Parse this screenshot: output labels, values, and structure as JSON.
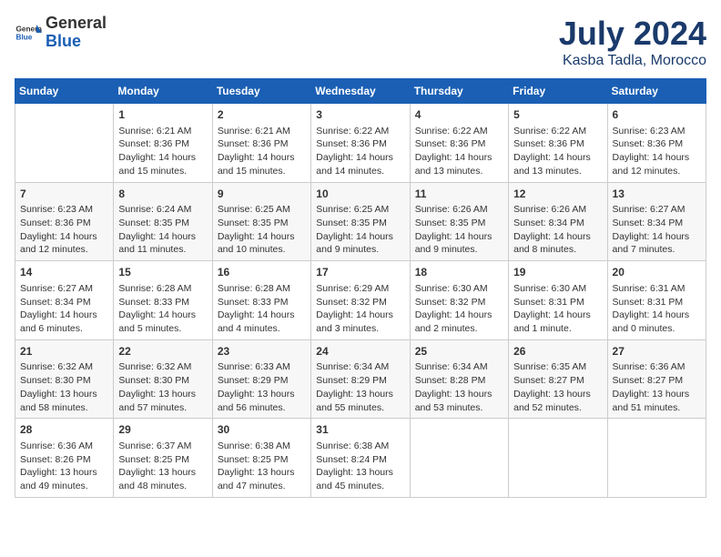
{
  "header": {
    "logo_general": "General",
    "logo_blue": "Blue",
    "month": "July 2024",
    "location": "Kasba Tadla, Morocco"
  },
  "days_of_week": [
    "Sunday",
    "Monday",
    "Tuesday",
    "Wednesday",
    "Thursday",
    "Friday",
    "Saturday"
  ],
  "weeks": [
    [
      {
        "day": "",
        "info": ""
      },
      {
        "day": "1",
        "info": "Sunrise: 6:21 AM\nSunset: 8:36 PM\nDaylight: 14 hours\nand 15 minutes."
      },
      {
        "day": "2",
        "info": "Sunrise: 6:21 AM\nSunset: 8:36 PM\nDaylight: 14 hours\nand 15 minutes."
      },
      {
        "day": "3",
        "info": "Sunrise: 6:22 AM\nSunset: 8:36 PM\nDaylight: 14 hours\nand 14 minutes."
      },
      {
        "day": "4",
        "info": "Sunrise: 6:22 AM\nSunset: 8:36 PM\nDaylight: 14 hours\nand 13 minutes."
      },
      {
        "day": "5",
        "info": "Sunrise: 6:22 AM\nSunset: 8:36 PM\nDaylight: 14 hours\nand 13 minutes."
      },
      {
        "day": "6",
        "info": "Sunrise: 6:23 AM\nSunset: 8:36 PM\nDaylight: 14 hours\nand 12 minutes."
      }
    ],
    [
      {
        "day": "7",
        "info": "Sunrise: 6:23 AM\nSunset: 8:36 PM\nDaylight: 14 hours\nand 12 minutes."
      },
      {
        "day": "8",
        "info": "Sunrise: 6:24 AM\nSunset: 8:35 PM\nDaylight: 14 hours\nand 11 minutes."
      },
      {
        "day": "9",
        "info": "Sunrise: 6:25 AM\nSunset: 8:35 PM\nDaylight: 14 hours\nand 10 minutes."
      },
      {
        "day": "10",
        "info": "Sunrise: 6:25 AM\nSunset: 8:35 PM\nDaylight: 14 hours\nand 9 minutes."
      },
      {
        "day": "11",
        "info": "Sunrise: 6:26 AM\nSunset: 8:35 PM\nDaylight: 14 hours\nand 9 minutes."
      },
      {
        "day": "12",
        "info": "Sunrise: 6:26 AM\nSunset: 8:34 PM\nDaylight: 14 hours\nand 8 minutes."
      },
      {
        "day": "13",
        "info": "Sunrise: 6:27 AM\nSunset: 8:34 PM\nDaylight: 14 hours\nand 7 minutes."
      }
    ],
    [
      {
        "day": "14",
        "info": "Sunrise: 6:27 AM\nSunset: 8:34 PM\nDaylight: 14 hours\nand 6 minutes."
      },
      {
        "day": "15",
        "info": "Sunrise: 6:28 AM\nSunset: 8:33 PM\nDaylight: 14 hours\nand 5 minutes."
      },
      {
        "day": "16",
        "info": "Sunrise: 6:28 AM\nSunset: 8:33 PM\nDaylight: 14 hours\nand 4 minutes."
      },
      {
        "day": "17",
        "info": "Sunrise: 6:29 AM\nSunset: 8:32 PM\nDaylight: 14 hours\nand 3 minutes."
      },
      {
        "day": "18",
        "info": "Sunrise: 6:30 AM\nSunset: 8:32 PM\nDaylight: 14 hours\nand 2 minutes."
      },
      {
        "day": "19",
        "info": "Sunrise: 6:30 AM\nSunset: 8:31 PM\nDaylight: 14 hours\nand 1 minute."
      },
      {
        "day": "20",
        "info": "Sunrise: 6:31 AM\nSunset: 8:31 PM\nDaylight: 14 hours\nand 0 minutes."
      }
    ],
    [
      {
        "day": "21",
        "info": "Sunrise: 6:32 AM\nSunset: 8:30 PM\nDaylight: 13 hours\nand 58 minutes."
      },
      {
        "day": "22",
        "info": "Sunrise: 6:32 AM\nSunset: 8:30 PM\nDaylight: 13 hours\nand 57 minutes."
      },
      {
        "day": "23",
        "info": "Sunrise: 6:33 AM\nSunset: 8:29 PM\nDaylight: 13 hours\nand 56 minutes."
      },
      {
        "day": "24",
        "info": "Sunrise: 6:34 AM\nSunset: 8:29 PM\nDaylight: 13 hours\nand 55 minutes."
      },
      {
        "day": "25",
        "info": "Sunrise: 6:34 AM\nSunset: 8:28 PM\nDaylight: 13 hours\nand 53 minutes."
      },
      {
        "day": "26",
        "info": "Sunrise: 6:35 AM\nSunset: 8:27 PM\nDaylight: 13 hours\nand 52 minutes."
      },
      {
        "day": "27",
        "info": "Sunrise: 6:36 AM\nSunset: 8:27 PM\nDaylight: 13 hours\nand 51 minutes."
      }
    ],
    [
      {
        "day": "28",
        "info": "Sunrise: 6:36 AM\nSunset: 8:26 PM\nDaylight: 13 hours\nand 49 minutes."
      },
      {
        "day": "29",
        "info": "Sunrise: 6:37 AM\nSunset: 8:25 PM\nDaylight: 13 hours\nand 48 minutes."
      },
      {
        "day": "30",
        "info": "Sunrise: 6:38 AM\nSunset: 8:25 PM\nDaylight: 13 hours\nand 47 minutes."
      },
      {
        "day": "31",
        "info": "Sunrise: 6:38 AM\nSunset: 8:24 PM\nDaylight: 13 hours\nand 45 minutes."
      },
      {
        "day": "",
        "info": ""
      },
      {
        "day": "",
        "info": ""
      },
      {
        "day": "",
        "info": ""
      }
    ]
  ]
}
